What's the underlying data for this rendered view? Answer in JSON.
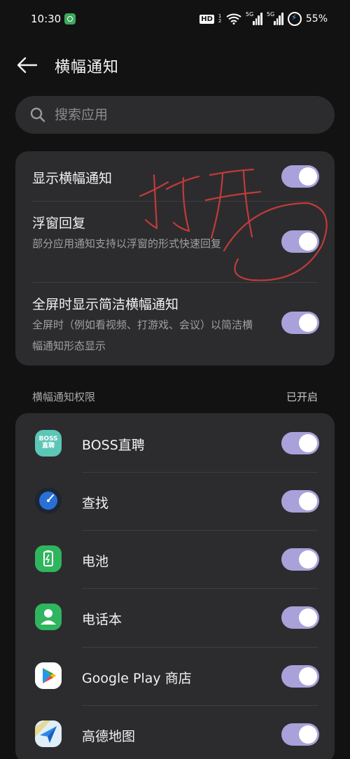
{
  "status_bar": {
    "time": "10:30",
    "hd": "HD",
    "sim1_digit": "1",
    "sim2_digit": "2",
    "net1": "5G",
    "net2": "5G",
    "battery": "55%"
  },
  "header": {
    "title": "横幅通知"
  },
  "search": {
    "placeholder": "搜索应用",
    "value": ""
  },
  "settings": [
    {
      "label": "显示横幅通知",
      "description": "",
      "enabled": true
    },
    {
      "label": "浮窗回复",
      "description": "部分应用通知支持以浮窗的形式快速回复",
      "enabled": true
    },
    {
      "label": "全屏时显示简洁横幅通知",
      "description": "全屏时（例如看视频、打游戏、会议）以简洁横幅通知形态显示",
      "enabled": true
    }
  ],
  "permissions": {
    "title": "横幅通知权限",
    "status": "已开启",
    "apps": [
      {
        "name": "BOSS直聘",
        "icon": "boss-zhipin-app-icon",
        "enabled": true,
        "icon_text": "BOSS 直聘"
      },
      {
        "name": "查找",
        "icon": "find-device-app-icon",
        "enabled": true
      },
      {
        "name": "电池",
        "icon": "battery-app-icon",
        "enabled": true
      },
      {
        "name": "电话本",
        "icon": "contacts-app-icon",
        "enabled": true
      },
      {
        "name": "Google Play 商店",
        "icon": "google-play-app-icon",
        "enabled": true
      },
      {
        "name": "高德地图",
        "icon": "amap-app-icon",
        "enabled": true
      }
    ]
  },
  "handwritten_annotation": "打开",
  "colors": {
    "background": "#121212",
    "card": "#2c2c2e",
    "toggle_on": "#a9a1d9",
    "annotation": "#c23a3a"
  }
}
